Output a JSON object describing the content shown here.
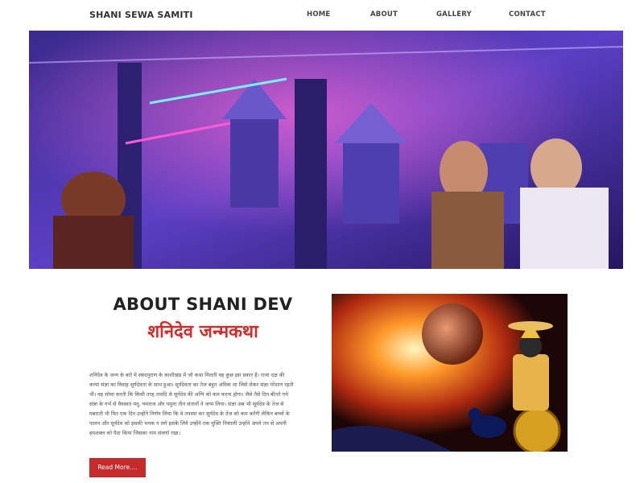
{
  "header": {
    "brand": "SHANI SEWA SAMITI",
    "nav": [
      "HOME",
      "ABOUT",
      "GALLERY",
      "CONTACT"
    ]
  },
  "about": {
    "title": "ABOUT SHANI DEV",
    "subtitle": "शनिदेव जन्मकथा",
    "body": "शनिदेव के जन्म के बारे में स्कंदपुराण के काशीखंड में जो कथा मिलती वह कुछ इस प्रकार है। राजा दक्ष की कन्या संज्ञा का विवाह सूर्यदेवता के साथ हुआ। सूर्यदेवता का तेज बहुत अधिक था जिसे लेकर संज्ञा परेशान रहती थी। वह सोचा करती कि किसी तरह तपादि से सूर्यदेव की अग्नि को कम करना होगा। जैसे तैसे दिन बीतते गये संज्ञा के गर्भ से वैवस्वत मनु, यमराज और यमुना तीन संतानों ने जन्म लिया। संज्ञा अब भी सूर्यदेव के तेज से घबराती थी फिर एक दिन उन्होंने निर्णय लिया कि वे तपस्या कर सूर्यदेव के तेज को कम करेंगी लेकिन बच्चों के पालन और सूर्यदेव को इसकी भनक न लगे इसके लिये उन्होंने एक युक्ति निकाली उन्होंने अपने तप से अपनी हमशक्ल को पैदा किया जिसका नाम संवर्णा रखा।",
    "read_more": "Read More...."
  },
  "colors": {
    "accent_red": "#d62b2b",
    "button_red": "#c62b2b"
  }
}
